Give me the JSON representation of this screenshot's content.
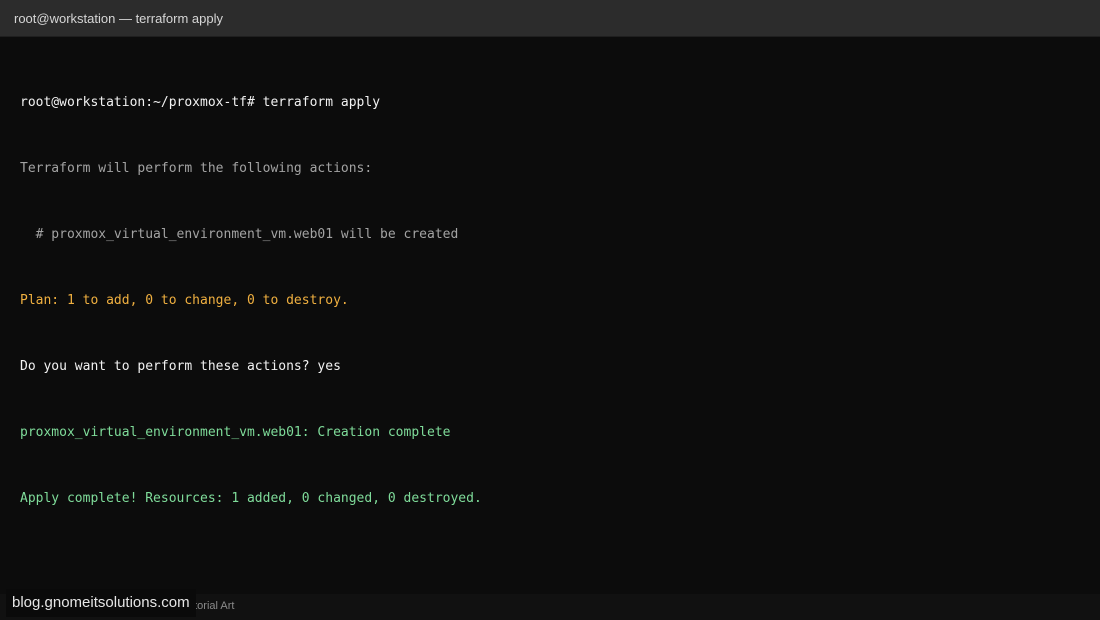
{
  "window": {
    "title": "root@workstation — terraform apply"
  },
  "terminal": {
    "lines": [
      {
        "text": "root@workstation:~/proxmox-tf# terraform apply",
        "color": "#f2f2f2"
      },
      {
        "text": "Terraform will perform the following actions:",
        "color": "#a3a3a3"
      },
      {
        "text": "  # proxmox_virtual_environment_vm.web01 will be created",
        "color": "#a3a3a3"
      },
      {
        "text": "Plan: 1 to add, 0 to change, 0 to destroy.",
        "color": "#f0b040"
      },
      {
        "text": "Do you want to perform these actions? yes",
        "color": "#f2f2f2"
      },
      {
        "text": "proxmox_virtual_environment_vm.web01: Creation complete",
        "color": "#7fdc9a"
      },
      {
        "text": "Apply complete! Resources: 1 added, 0 changed, 0 destroyed.",
        "color": "#7fdc9a"
      }
    ]
  },
  "footer": {
    "credit_visible_fragment": "utorial Art"
  },
  "watermark": {
    "text": "blog.gnomeitsolutions.com"
  }
}
